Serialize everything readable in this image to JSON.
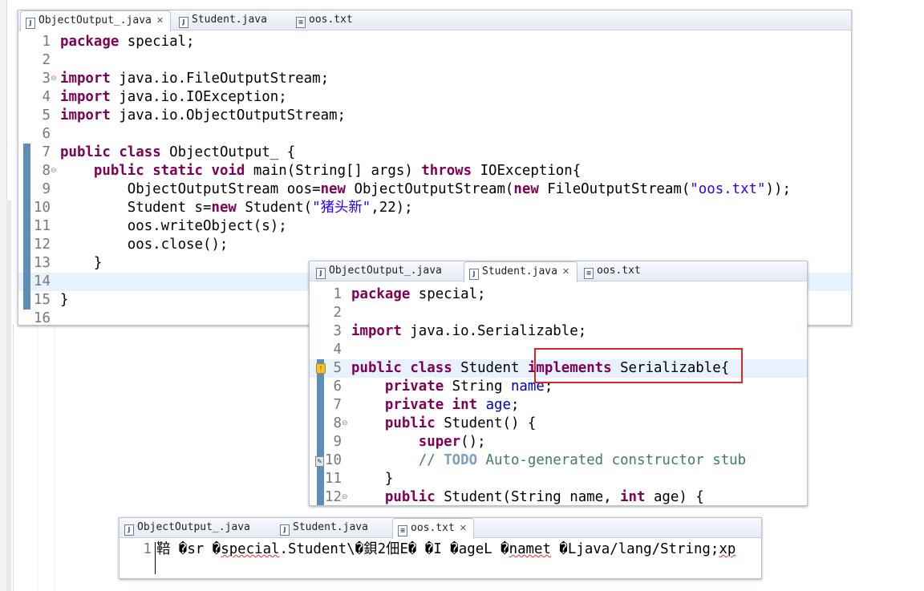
{
  "editor1": {
    "tabs": [
      {
        "label": "ObjectOutput_.java",
        "active": true,
        "closable": true
      },
      {
        "label": "Student.java",
        "active": false,
        "closable": false
      },
      {
        "label": "oos.txt",
        "active": false,
        "closable": false
      }
    ],
    "lines": [
      {
        "n": "1",
        "parts": [
          [
            "kw",
            "package"
          ],
          [
            "t",
            " special;"
          ]
        ]
      },
      {
        "n": "2",
        "parts": []
      },
      {
        "n": "3",
        "parts": [
          [
            "kw",
            "import"
          ],
          [
            "t",
            " java.io.FileOutputStream;"
          ]
        ],
        "fold": true
      },
      {
        "n": "4",
        "parts": [
          [
            "kw",
            "import"
          ],
          [
            "t",
            " java.io.IOException;"
          ]
        ]
      },
      {
        "n": "5",
        "parts": [
          [
            "kw",
            "import"
          ],
          [
            "t",
            " java.io.ObjectOutputStream;"
          ]
        ]
      },
      {
        "n": "6",
        "parts": []
      },
      {
        "n": "7",
        "parts": [
          [
            "kw",
            "public"
          ],
          [
            "t",
            " "
          ],
          [
            "kw",
            "class"
          ],
          [
            "t",
            " ObjectOutput_ {"
          ]
        ],
        "marked": true
      },
      {
        "n": "8",
        "parts": [
          [
            "t",
            "    "
          ],
          [
            "kw",
            "public"
          ],
          [
            "t",
            " "
          ],
          [
            "kw",
            "static"
          ],
          [
            "t",
            " "
          ],
          [
            "kw",
            "void"
          ],
          [
            "t",
            " main(String[] args) "
          ],
          [
            "kw",
            "throws"
          ],
          [
            "t",
            " IOException{"
          ]
        ],
        "marked": true,
        "fold": true
      },
      {
        "n": "9",
        "parts": [
          [
            "t",
            "        ObjectOutputStream oos="
          ],
          [
            "kw",
            "new"
          ],
          [
            "t",
            " ObjectOutputStream("
          ],
          [
            "kw",
            "new"
          ],
          [
            "t",
            " FileOutputStream("
          ],
          [
            "str",
            "\"oos.txt\""
          ],
          [
            "t",
            "));"
          ]
        ],
        "marked": true
      },
      {
        "n": "10",
        "parts": [
          [
            "t",
            "        Student s="
          ],
          [
            "kw",
            "new"
          ],
          [
            "t",
            " Student("
          ],
          [
            "str",
            "\"猪头新\""
          ],
          [
            "t",
            ",22);"
          ]
        ],
        "marked": true
      },
      {
        "n": "11",
        "parts": [
          [
            "t",
            "        oos.writeObject(s);"
          ]
        ],
        "marked": true
      },
      {
        "n": "12",
        "parts": [
          [
            "t",
            "        oos.close();"
          ]
        ],
        "marked": true
      },
      {
        "n": "13",
        "parts": [
          [
            "t",
            "    }"
          ]
        ],
        "marked": true
      },
      {
        "n": "14",
        "parts": [],
        "marked": true,
        "highlight": true
      },
      {
        "n": "15",
        "parts": [
          [
            "t",
            "}"
          ]
        ],
        "marked": true
      },
      {
        "n": "16",
        "parts": []
      }
    ]
  },
  "editor2": {
    "tabs": [
      {
        "label": "ObjectOutput_.java",
        "active": false,
        "closable": false
      },
      {
        "label": "Student.java",
        "active": true,
        "closable": true
      },
      {
        "label": "oos.txt",
        "active": false,
        "closable": false
      }
    ],
    "lines": [
      {
        "n": "1",
        "parts": [
          [
            "kw",
            "package"
          ],
          [
            "t",
            " special;"
          ]
        ]
      },
      {
        "n": "2",
        "parts": []
      },
      {
        "n": "3",
        "parts": [
          [
            "kw",
            "import"
          ],
          [
            "t",
            " java.io.Serializable;"
          ]
        ]
      },
      {
        "n": "4",
        "parts": []
      },
      {
        "n": "5",
        "parts": [
          [
            "kw",
            "public"
          ],
          [
            "t",
            " "
          ],
          [
            "kw",
            "class"
          ],
          [
            "t",
            " Student "
          ],
          [
            "kw",
            "implements"
          ],
          [
            "t",
            " Serializable{"
          ]
        ],
        "marked": true,
        "highlight": true,
        "warn": true
      },
      {
        "n": "6",
        "parts": [
          [
            "t",
            "    "
          ],
          [
            "kw",
            "private"
          ],
          [
            "t",
            " String "
          ],
          [
            "fld",
            "name"
          ],
          [
            "t",
            ";"
          ]
        ],
        "marked": true
      },
      {
        "n": "7",
        "parts": [
          [
            "t",
            "    "
          ],
          [
            "kw",
            "private"
          ],
          [
            "t",
            " "
          ],
          [
            "kw",
            "int"
          ],
          [
            "t",
            " "
          ],
          [
            "fld",
            "age"
          ],
          [
            "t",
            ";"
          ]
        ],
        "marked": true
      },
      {
        "n": "8",
        "parts": [
          [
            "t",
            "    "
          ],
          [
            "kw",
            "public"
          ],
          [
            "t",
            " Student() {"
          ]
        ],
        "marked": true,
        "fold": true
      },
      {
        "n": "9",
        "parts": [
          [
            "t",
            "        "
          ],
          [
            "kw",
            "super"
          ],
          [
            "t",
            "();"
          ]
        ],
        "marked": true
      },
      {
        "n": "10",
        "parts": [
          [
            "t",
            "        "
          ],
          [
            "cmt",
            "// "
          ],
          [
            "todo",
            "TODO"
          ],
          [
            "cmt",
            " Auto-generated constructor stub"
          ]
        ],
        "marked": true,
        "task": true
      },
      {
        "n": "11",
        "parts": [
          [
            "t",
            "    }"
          ]
        ],
        "marked": true
      },
      {
        "n": "12",
        "parts": [
          [
            "t",
            "    "
          ],
          [
            "kw",
            "public"
          ],
          [
            "t",
            " Student(String name, "
          ],
          [
            "kw",
            "int"
          ],
          [
            "t",
            " age) {"
          ]
        ],
        "marked": true,
        "fold": true
      }
    ]
  },
  "editor3": {
    "tabs": [
      {
        "label": "ObjectOutput_.java",
        "active": false,
        "closable": false
      },
      {
        "label": "Student.java",
        "active": false,
        "closable": false
      },
      {
        "label": "oos.txt",
        "active": true,
        "closable": true
      }
    ],
    "lines": [
      {
        "n": "1",
        "parts": [
          [
            "t",
            "﻿"
          ],
          [
            "garble",
            "鞛 �sr �"
          ],
          [
            "squig",
            "special"
          ],
          [
            "garble",
            ".Student\\�鋇2佃E� �I �ageL �"
          ],
          [
            "squig",
            "namet"
          ],
          [
            "garble",
            " �Ljava/lang/String;"
          ],
          [
            "squig",
            "xp"
          ]
        ]
      }
    ]
  }
}
